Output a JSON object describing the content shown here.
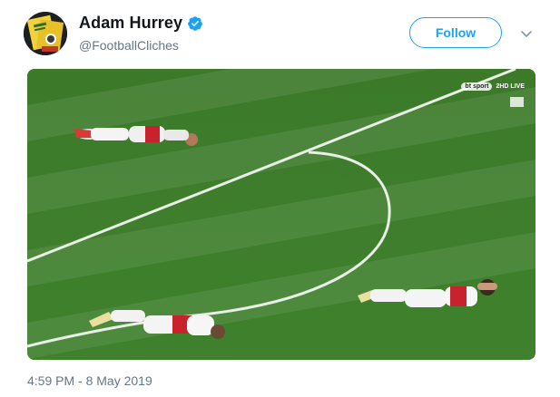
{
  "tweet": {
    "author": {
      "display_name": "Adam Hurrey",
      "handle": "@FootballCliches",
      "verified": true
    },
    "follow_label": "Follow",
    "timestamp": "4:59 PM - 8 May 2019",
    "media": {
      "broadcast": {
        "channel_logo": "bt sport",
        "label": "2HD LIVE"
      }
    }
  },
  "colors": {
    "accent": "#1da1f2",
    "name": "#14171a",
    "secondary_text": "#657786",
    "pitch_green": "#3f7c2c"
  },
  "icons": {
    "verified": "verified-badge-icon",
    "menu": "chevron-down-icon"
  }
}
